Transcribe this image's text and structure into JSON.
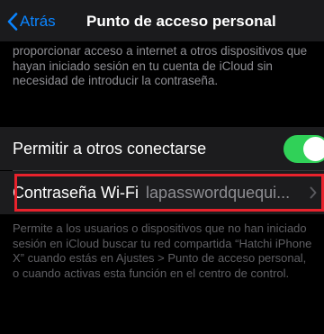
{
  "nav": {
    "back_label": "Atrás",
    "title": "Punto de acceso personal"
  },
  "description_top": "proporcionar acceso a internet a otros dispositivos que hayan iniciado sesión en tu cuenta de iCloud sin necesidad de introducir la contraseña.",
  "allow_others": {
    "label": "Permitir a otros conectarse",
    "enabled": true
  },
  "wifi_password": {
    "label": "Contraseña Wi-Fi",
    "value": "lapasswordquequi..."
  },
  "description_bottom": "Permite a los usuarios o dispositivos que no han iniciado sesión en iCloud buscar tu red compartida “Hatchi iPhone X” cuando estás en Ajustes > Punto de acceso personal, o cuando activas esta función en el centro de control.",
  "icons": {
    "back": "chevron-left-icon",
    "disclosure": "chevron-right-icon"
  },
  "colors": {
    "accent": "#0a84ff",
    "toggle_on": "#30d158",
    "highlight": "#e8222c",
    "background": "#000000",
    "cell": "#1c1c1e"
  }
}
